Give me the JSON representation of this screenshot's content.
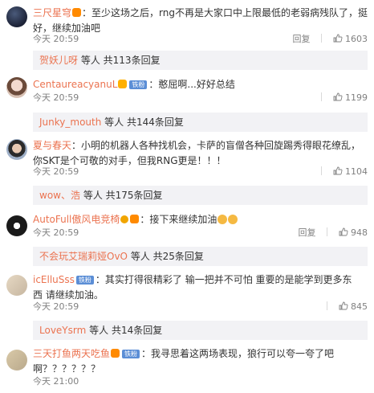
{
  "comments": [
    {
      "username": "三尺星穹",
      "text_line1": "：至少这场之后，rng不再是大家口中上限最低的老弱病残队了，挺",
      "text_line2": "好，继续加油吧",
      "time": "今天 20:59",
      "reply_label": "回复",
      "likes": "1603",
      "replies": {
        "user": "贺妖儿呀",
        "text": "等人 共113条回复"
      }
    },
    {
      "username": "CentaureacyanuL",
      "chip": "铁粉",
      "text_line1": "：憨屈啊...好好总结",
      "time": "今天 20:59",
      "likes": "1199",
      "replies": {
        "user": "Junky_mouth",
        "text": "等人 共144条回复"
      }
    },
    {
      "username": "夏与春天",
      "text_line1": "：小明的机器人各种找机会，卡萨的盲僧各种回旋踢秀得眼花缭乱，",
      "text_line2": "你SKT是个可敬的对手，但我RNG更是！！！",
      "time": "今天 20:59",
      "likes": "1104",
      "replies": {
        "user": "wow、浩",
        "text": "等人 共175条回复"
      }
    },
    {
      "username": "AutoFull傲风电竞椅",
      "text_line1": "：接下来继续加油",
      "time": "今天 20:59",
      "reply_label": "回复",
      "likes": "948",
      "replies": {
        "user": "不会玩艾瑞莉娅OvO",
        "text": "等人 共25条回复"
      }
    },
    {
      "username": "icElluSss",
      "chip": "铁粉",
      "text_line1": "：其实打得很精彩了 输一把并不可怕 重要的是能学到更多东",
      "text_line2": "西 请继续加油。",
      "time": "今天 20:59",
      "likes": "845",
      "replies": {
        "user": "LoveYsrm",
        "text": "等人 共14条回复"
      }
    },
    {
      "username": "三天打鱼两天吃鱼",
      "chip": "铁粉",
      "text_line1": "：我寻思着这两场表现，狼行可以夸一夸了吧",
      "text_line2": "啊？？？？？？",
      "time": "今天 21:00"
    }
  ]
}
